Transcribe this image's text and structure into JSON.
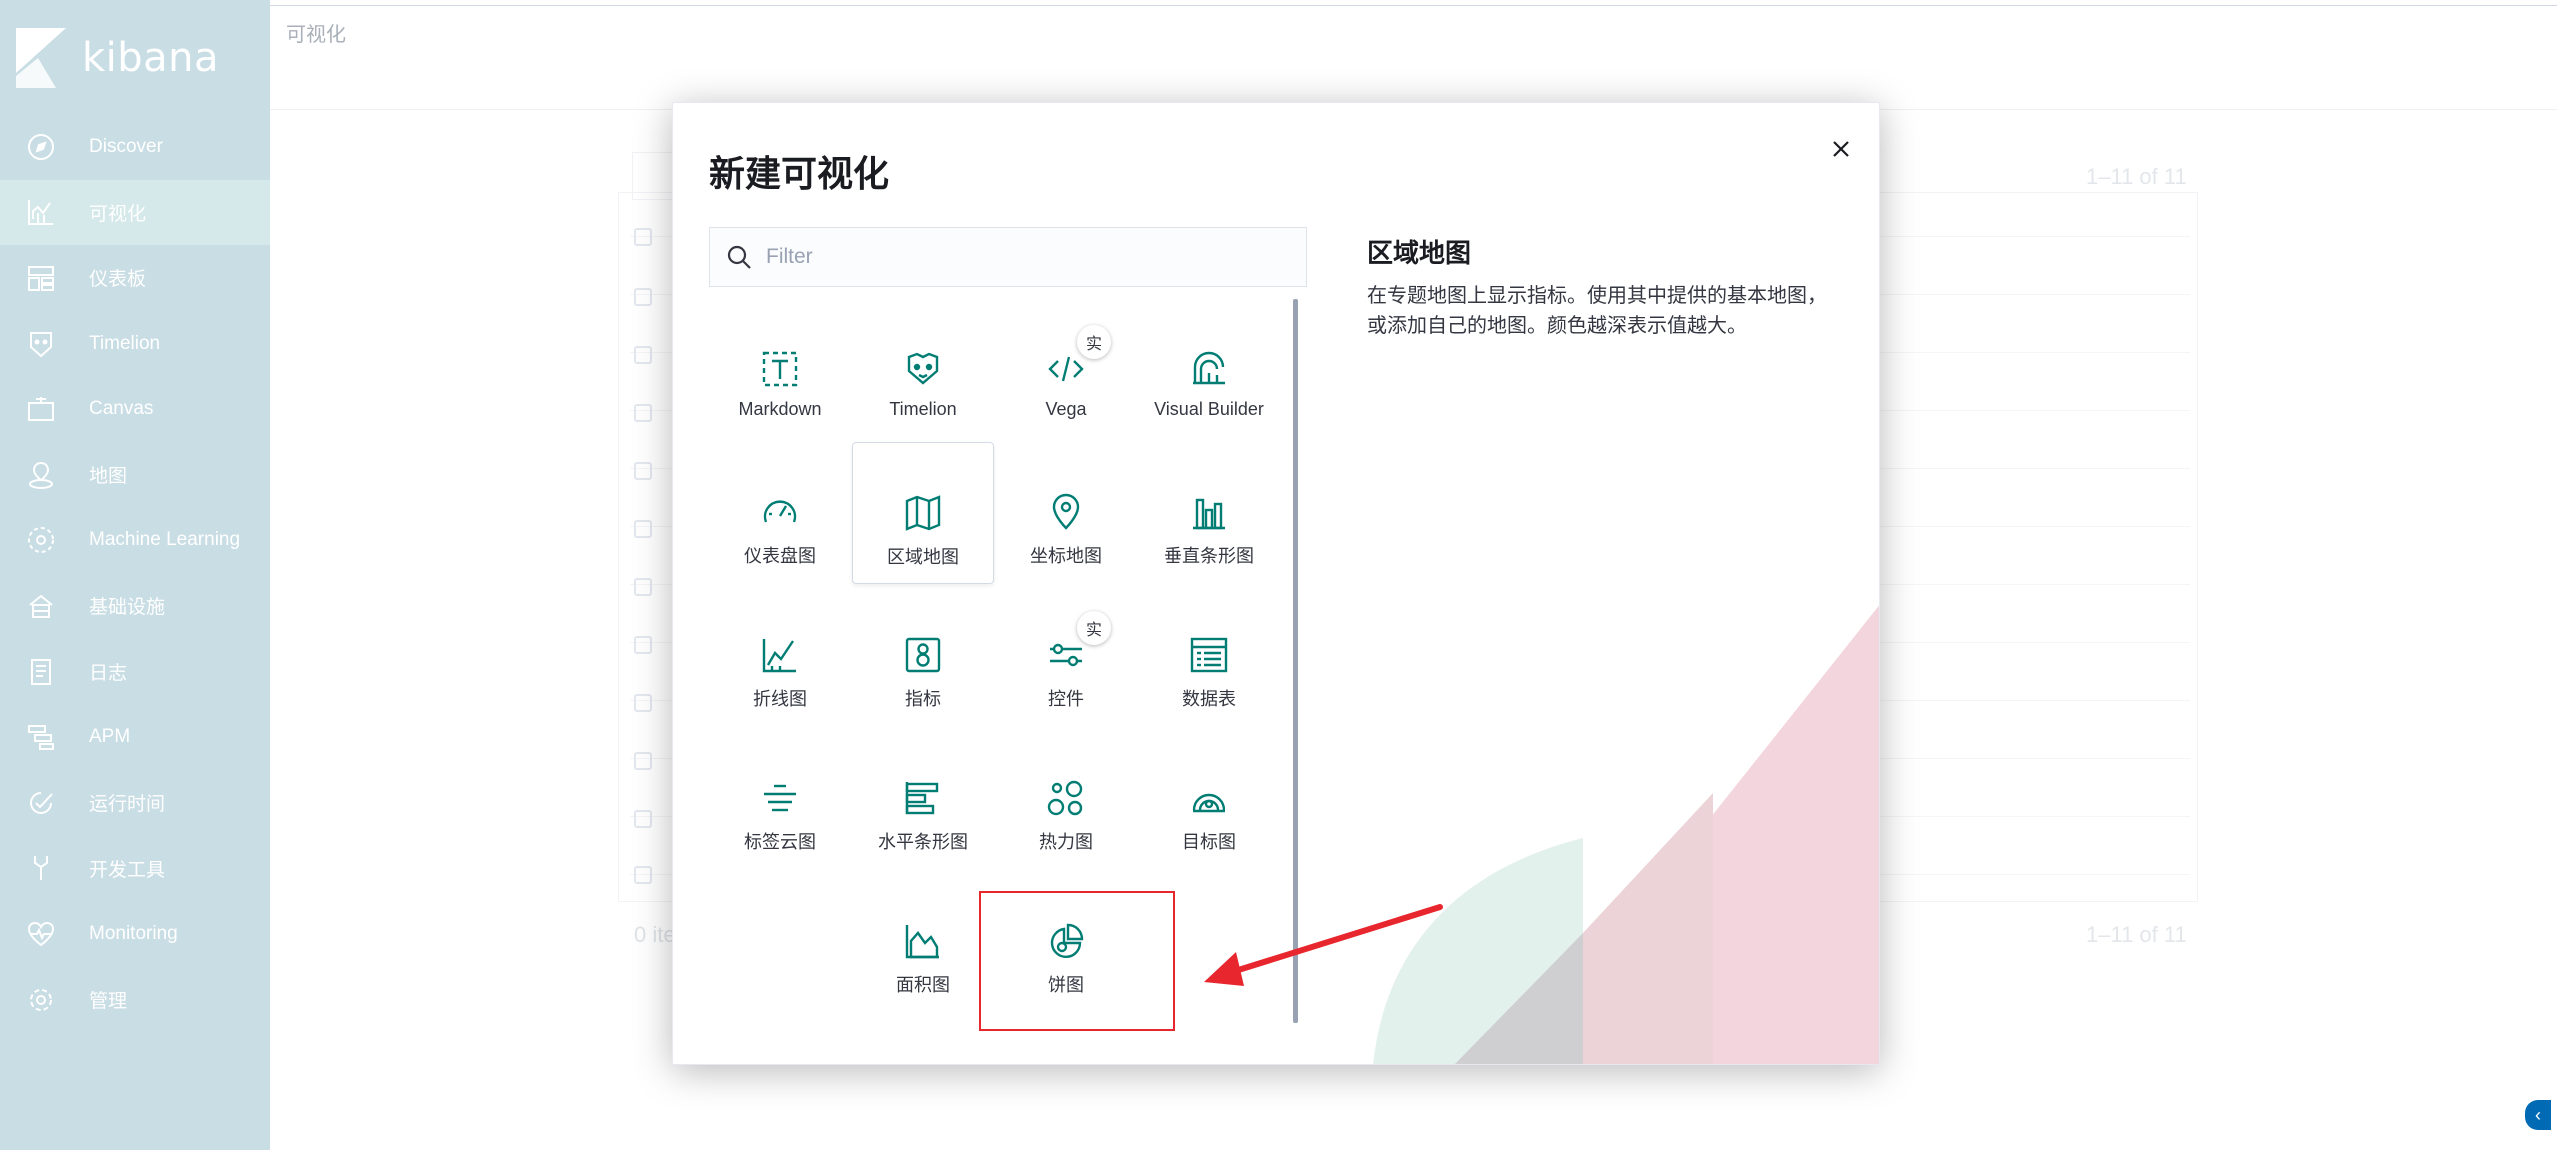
{
  "sidebar": {
    "logo_text": "kibana",
    "items": [
      {
        "label": "Discover",
        "icon": "compass-icon"
      },
      {
        "label": "可视化",
        "icon": "visualize-icon",
        "active": true
      },
      {
        "label": "仪表板",
        "icon": "dashboard-icon"
      },
      {
        "label": "Timelion",
        "icon": "timelion-icon"
      },
      {
        "label": "Canvas",
        "icon": "canvas-icon"
      },
      {
        "label": "地图",
        "icon": "maps-icon"
      },
      {
        "label": "Machine Learning",
        "icon": "ml-icon"
      },
      {
        "label": "基础设施",
        "icon": "infrastructure-icon"
      },
      {
        "label": "日志",
        "icon": "logs-icon"
      },
      {
        "label": "APM",
        "icon": "apm-icon"
      },
      {
        "label": "运行时间",
        "icon": "uptime-icon"
      },
      {
        "label": "开发工具",
        "icon": "devtools-icon"
      },
      {
        "label": "Monitoring",
        "icon": "monitoring-icon"
      },
      {
        "label": "管理",
        "icon": "gear-icon"
      }
    ]
  },
  "page": {
    "breadcrumb": "可视化",
    "pager_top": "1–11 of 11",
    "pager_bottom": "1–11 of 11",
    "items_text": "0 ite"
  },
  "modal": {
    "title": "新建可视化",
    "filter_placeholder": "Filter",
    "experimental_badge": "实",
    "tiles": [
      {
        "label": "Markdown",
        "icon": "markdown-icon"
      },
      {
        "label": "Timelion",
        "icon": "timelion-icon"
      },
      {
        "label": "Vega",
        "icon": "code-icon",
        "experimental": true
      },
      {
        "label": "Visual Builder",
        "icon": "visual-builder-icon"
      },
      {
        "label": "仪表盘图",
        "icon": "gauge-icon"
      },
      {
        "label": "区域地图",
        "icon": "region-map-icon",
        "selected": true
      },
      {
        "label": "坐标地图",
        "icon": "map-pin-icon"
      },
      {
        "label": "垂直条形图",
        "icon": "vertical-bar-icon"
      },
      {
        "label": "折线图",
        "icon": "line-chart-icon"
      },
      {
        "label": "指标",
        "icon": "metric-icon"
      },
      {
        "label": "控件",
        "icon": "controls-icon",
        "experimental": true
      },
      {
        "label": "数据表",
        "icon": "table-icon"
      },
      {
        "label": "标签云图",
        "icon": "tag-cloud-icon"
      },
      {
        "label": "水平条形图",
        "icon": "horizontal-bar-icon"
      },
      {
        "label": "热力图",
        "icon": "heatmap-icon"
      },
      {
        "label": "目标图",
        "icon": "goal-icon"
      },
      {
        "label": "面积图",
        "icon": "area-chart-icon"
      },
      {
        "label": "饼图",
        "icon": "pie-chart-icon"
      }
    ],
    "description": {
      "title": "区域地图",
      "text": "在专题地图上显示指标。使用其中提供的基本地图，或添加自己的地图。颜色越深表示值越大。"
    }
  },
  "colors": {
    "sidebar_bg": "#c9dde4",
    "icon_teal": "#017d73",
    "annotation_red": "#e8262e",
    "link_blue": "#006bb4"
  }
}
